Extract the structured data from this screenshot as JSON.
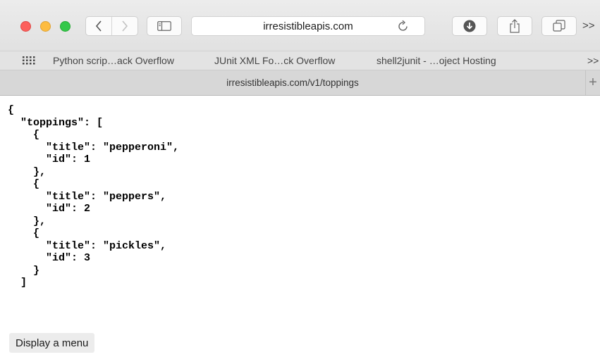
{
  "toolbar": {
    "address": "irresistibleapis.com",
    "overflow_label": ">>"
  },
  "bookmarks": {
    "items": [
      "Python scrip…ack Overflow",
      "JUnit XML Fo…ck Overflow",
      "shell2junit - …oject Hosting"
    ],
    "more_label": ">>"
  },
  "tabs": {
    "active_title": "irresistibleapis.com/v1/toppings",
    "new_tab_label": "+"
  },
  "content": {
    "json_text": "{\n  \"toppings\": [\n    {\n      \"title\": \"pepperoni\",\n      \"id\": 1\n    },\n    {\n      \"title\": \"peppers\",\n      \"id\": 2\n    },\n    {\n      \"title\": \"pickles\",\n      \"id\": 3\n    }\n  ]",
    "menu_button": "Display a menu"
  },
  "icons": {
    "back": "chevron-left-icon",
    "forward": "chevron-right-icon",
    "sidebar": "sidebar-icon",
    "reload": "reload-icon",
    "download": "download-icon",
    "share": "share-icon",
    "tabs": "tabs-icon",
    "apps": "grid-icon"
  }
}
